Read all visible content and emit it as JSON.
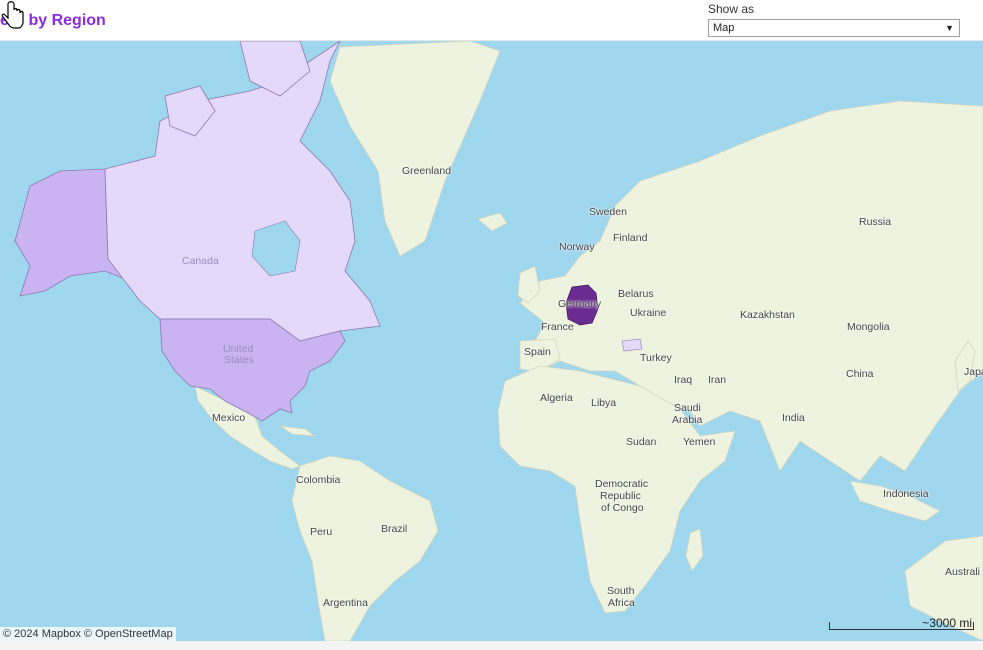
{
  "header": {
    "title": "ers by Region",
    "show_as_label": "Show as",
    "show_as_value": "Map"
  },
  "map": {
    "attribution": "© 2024 Mapbox  © OpenStreetMap",
    "scale_label": "~3000 mi",
    "colors": {
      "water": "#9fd7ef",
      "land": "#eef3e0",
      "us": "#c9b3f0",
      "canada": "#e4d9fb",
      "germany": "#6a2c91"
    },
    "labels": {
      "greenland": "Greenland",
      "canada": "Canada",
      "united_states_1": "United",
      "united_states_2": "States",
      "mexico": "Mexico",
      "colombia": "Colombia",
      "peru": "Peru",
      "brazil": "Brazil",
      "argentina": "Argentina",
      "sweden": "Sweden",
      "norway": "Norway",
      "finland": "Finland",
      "belarus": "Belarus",
      "ukraine": "Ukraine",
      "germany": "Germany",
      "france": "France",
      "spain": "Spain",
      "turkey": "Turkey",
      "russia": "Russia",
      "kazakhstan": "Kazakhstan",
      "mongolia": "Mongolia",
      "china": "China",
      "japan": "Japa",
      "iraq": "Iraq",
      "iran": "Iran",
      "saudi_arabia_1": "Saudi",
      "saudi_arabia_2": "Arabia",
      "yemen": "Yemen",
      "india": "India",
      "indonesia": "Indonesia",
      "algeria": "Algeria",
      "libya": "Libya",
      "sudan": "Sudan",
      "drc_1": "Democratic",
      "drc_2": "Republic",
      "drc_3": "of Congo",
      "south_africa_1": "South",
      "south_africa_2": "Africa",
      "australia": "Australi"
    }
  }
}
